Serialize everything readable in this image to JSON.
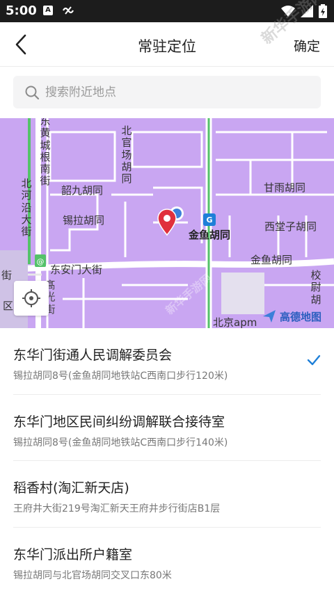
{
  "status_bar": {
    "time": "5:00",
    "app_icon": "A",
    "icons": [
      "wifi-icon",
      "signal-icon",
      "battery-icon"
    ]
  },
  "watermark": {
    "text": "新华手游网"
  },
  "nav": {
    "title": "常驻定位",
    "confirm_label": "确定",
    "back_icon": "chevron-left-icon"
  },
  "search": {
    "placeholder": "搜索附近地点",
    "icon": "search-icon"
  },
  "map": {
    "background_color": "#c9a6f2",
    "labels": {
      "dong_huangcheng_genan": "东黄城根南街",
      "bei_guanchang": "北官场胡同",
      "shaojiu": "韶九胡同",
      "beihe_yan": "北河沿大街",
      "xila": "锡拉胡同",
      "ganyu": "甘雨胡同",
      "jinyu": "金鱼胡同",
      "xitang": "西堂子胡同",
      "jinyu_2": "金鱼胡同",
      "dong_anmen": "东安门大街",
      "xiaowei": "校尉胡",
      "bei_edge_1": "街",
      "bei_edge_2": "区",
      "bei_guang": "北京apm",
      "gaoshan_partial": "髙光街",
      "amap_brand": "高德地图"
    },
    "locate_icon": "crosshair-icon",
    "pin_icon": "map-pin-icon",
    "metro_icon": "metro-icon"
  },
  "results": [
    {
      "name": "东华门街通人民调解委员会",
      "address": "锡拉胡同8号(金鱼胡同地铁站C西南口步行120米)",
      "selected": true
    },
    {
      "name": "东华门地区民间纠纷调解联合接待室",
      "address": "锡拉胡同8号(金鱼胡同地铁站C西南口步行140米)",
      "selected": false
    },
    {
      "name": "稻香村(淘汇新天店)",
      "address": "王府井大街219号淘汇新天王府井步行街店B1层",
      "selected": false
    },
    {
      "name": "东华门派出所户籍室",
      "address": "锡拉胡同与北官场胡同交叉口东80米",
      "selected": false
    }
  ],
  "colors": {
    "accent": "#1e7fd8",
    "pin": "#e0303c"
  }
}
